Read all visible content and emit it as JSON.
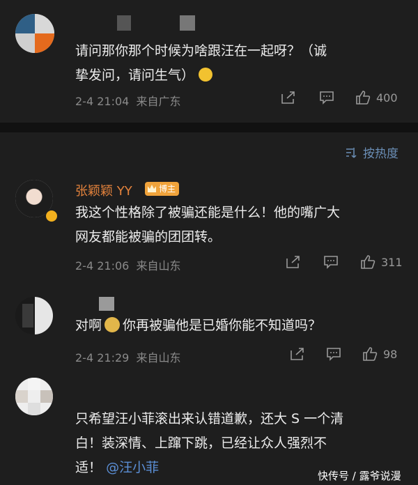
{
  "comments": [
    {
      "text": "请问那你那个时候为啥跟汪在一起呀？（诚挚发问，请问生气）",
      "line1": "请问那你那个时候为啥跟汪在一起呀？（诚",
      "line2": "挚发问，请问生气）",
      "time": "2-4 21:04",
      "location": "来自广东",
      "likes": "400"
    },
    {
      "name": "张颖颖 YY",
      "badge": "博主",
      "line1": "我这个性格除了被骗还能是什么！他的嘴广大",
      "line2": "网友都能被骗的团团转。",
      "time": "2-4 21:06",
      "location": "来自山东",
      "likes": "311"
    },
    {
      "line1": "对啊",
      "line1b": "你再被骗他是已婚你能不知道吗？",
      "time": "2-4 21:29",
      "location": "来自山东",
      "likes": "98"
    },
    {
      "line1": "只希望汪小菲滚出来认错道歉，还大 S 一个清",
      "line2": "白！装深情、上蹿下跳，已经让众人强烈不",
      "line3": "适！",
      "mention": "@汪小菲"
    }
  ],
  "sort": {
    "label": "按热度"
  },
  "watermark": "快传号 / 露爷说漫",
  "colors": {
    "name": "#e3823c",
    "mention": "#5b8fd6",
    "badge": "#f0a33b"
  }
}
